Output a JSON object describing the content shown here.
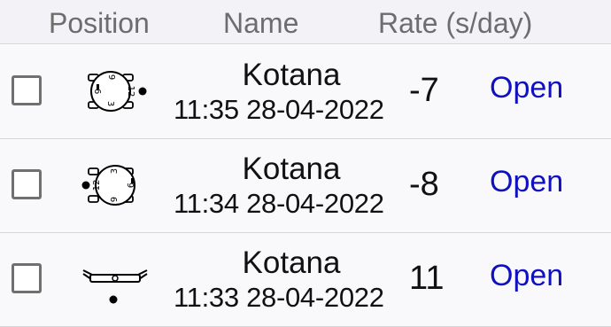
{
  "header": {
    "position": "Position",
    "name": "Name",
    "rate": "Rate (s/day)"
  },
  "rows": [
    {
      "position_icon": "watch-crown-left-icon",
      "name": "Kotana",
      "timestamp": "11:35 28-04-2022",
      "rate": "-7",
      "action": "Open",
      "dial_numbers": [
        "12",
        "3",
        "6",
        "9"
      ]
    },
    {
      "position_icon": "watch-crown-right-icon",
      "name": "Kotana",
      "timestamp": "11:34 28-04-2022",
      "rate": "-8",
      "action": "Open",
      "dial_numbers": [
        "12",
        "3",
        "6",
        "9"
      ]
    },
    {
      "position_icon": "watch-dial-down-icon",
      "name": "Kotana",
      "timestamp": "11:33 28-04-2022",
      "rate": "11",
      "action": "Open"
    }
  ],
  "colors": {
    "header_bg": "#f2f2f7",
    "row_bg": "#f9f9fb",
    "link": "#1010c0",
    "divider": "#d6d6d9"
  }
}
